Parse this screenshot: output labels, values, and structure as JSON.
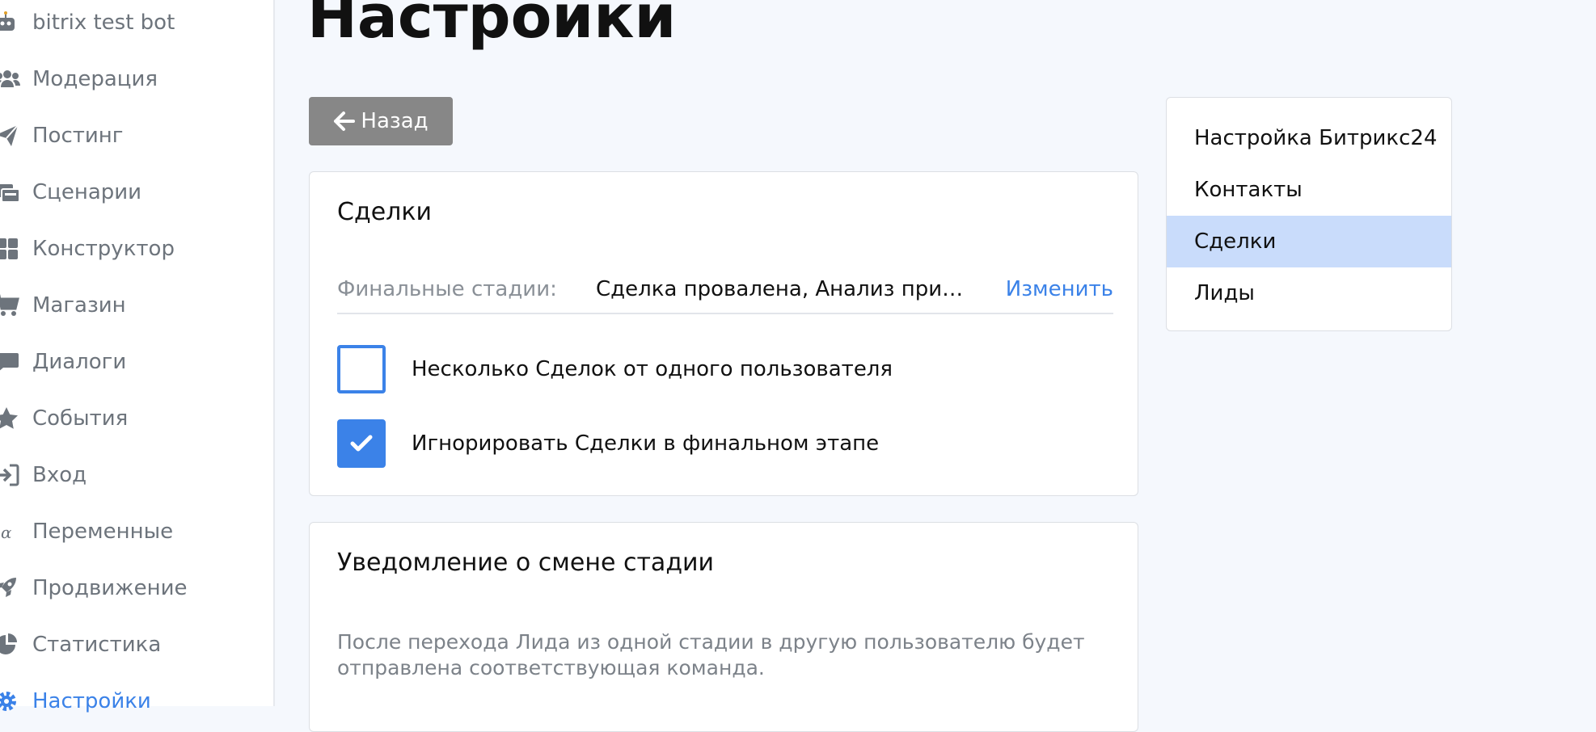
{
  "sidebar": {
    "items": [
      {
        "label": "bitrix test bot",
        "icon": "robot-icon"
      },
      {
        "label": "Модерация",
        "icon": "users-icon"
      },
      {
        "label": "Постинг",
        "icon": "paper-plane-icon"
      },
      {
        "label": "Сценарии",
        "icon": "scenarios-icon"
      },
      {
        "label": "Конструктор",
        "icon": "grid-icon"
      },
      {
        "label": "Магазин",
        "icon": "cart-icon"
      },
      {
        "label": "Диалоги",
        "icon": "chat-icon"
      },
      {
        "label": "События",
        "icon": "star-icon"
      },
      {
        "label": "Вход",
        "icon": "sign-in-icon"
      },
      {
        "label": "Переменные",
        "icon": "variable-icon"
      },
      {
        "label": "Продвижение",
        "icon": "rocket-icon"
      },
      {
        "label": "Статистика",
        "icon": "pie-chart-icon"
      },
      {
        "label": "Настройки",
        "icon": "gear-icon",
        "active": true
      }
    ],
    "accent_color": "#3b82e8"
  },
  "page": {
    "title": "Настройки"
  },
  "back_button": {
    "label": "Назад",
    "icon": "arrow-left-icon"
  },
  "deals_card": {
    "title": "Сделки",
    "final_stages": {
      "label": "Финальные стадии:",
      "value": "Сделка провалена, Анализ причины провала",
      "action": "Изменить"
    },
    "checkboxes": [
      {
        "label": "Несколько Сделок от одного пользователя",
        "checked": false
      },
      {
        "label": "Игнорировать Сделки в финальном этапе",
        "checked": true
      }
    ]
  },
  "notify_card": {
    "title": "Уведомление о смене стадии",
    "description": "После перехода Лида из одной стадии в другую пользователю будет отправлена соответствующая команда."
  },
  "side_menu": {
    "items": [
      {
        "label": "Настройка Битрикс24"
      },
      {
        "label": "Контакты"
      },
      {
        "label": "Сделки",
        "active": true
      },
      {
        "label": "Лиды"
      }
    ],
    "active_color": "#c9dcfb"
  }
}
